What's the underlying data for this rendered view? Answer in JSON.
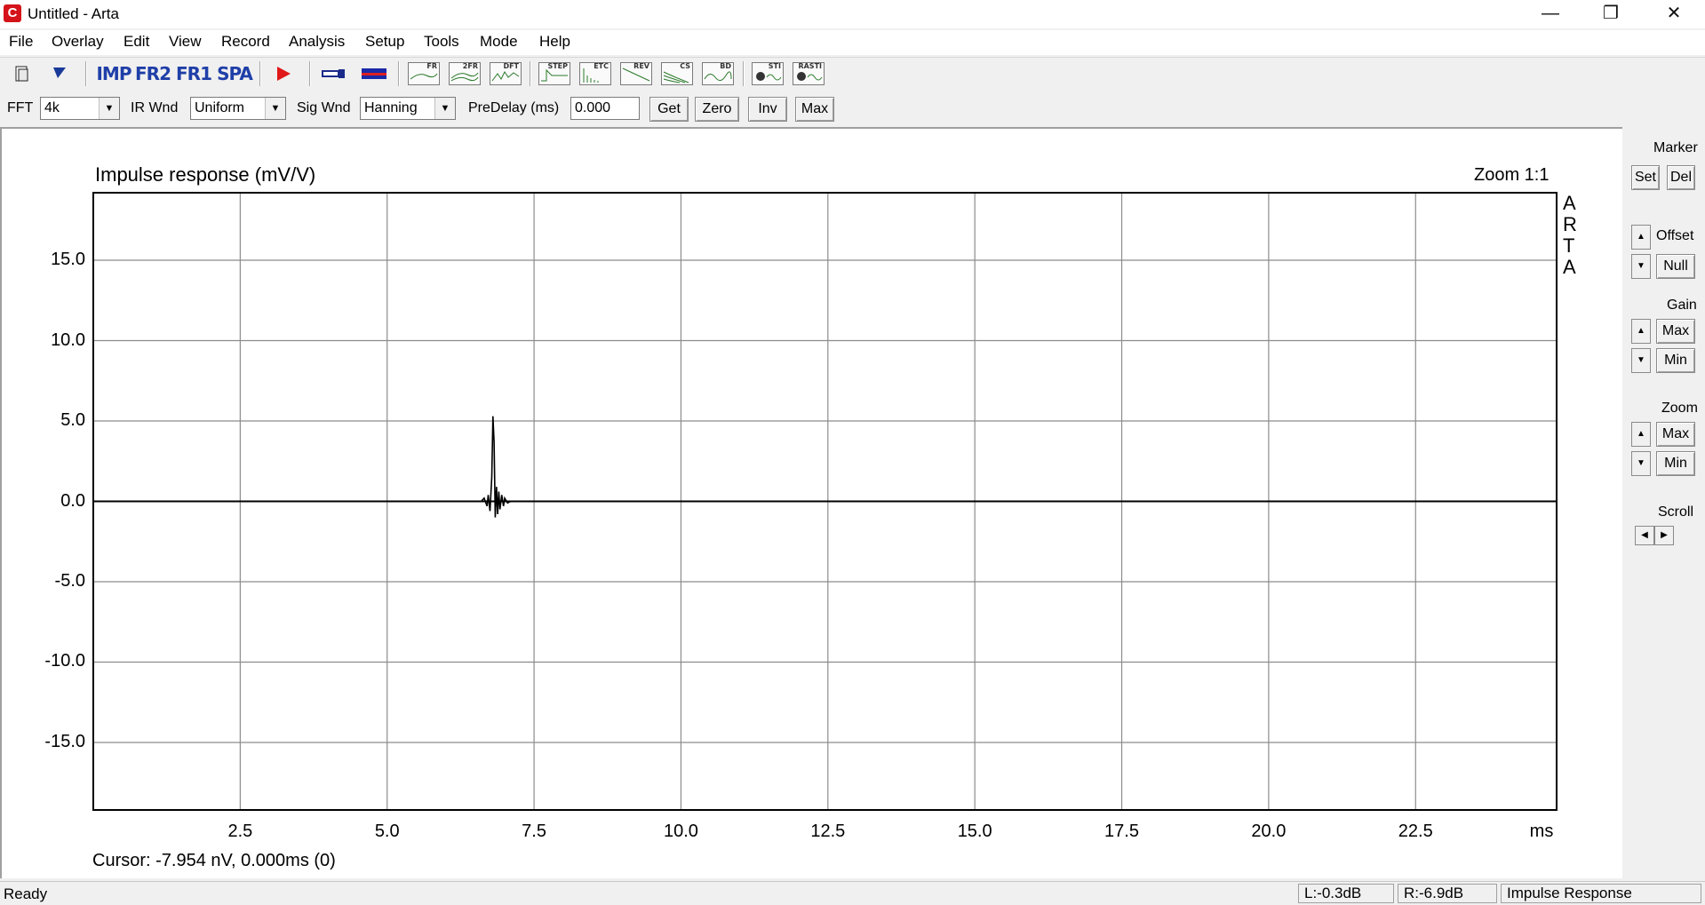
{
  "window": {
    "title": "Untitled - Arta",
    "app_icon_glyph": "C",
    "minimize_glyph": "—",
    "restore_glyph": "❐",
    "close_glyph": "✕"
  },
  "menu": [
    "File",
    "Overlay",
    "Edit",
    "View",
    "Record",
    "Analysis",
    "Setup",
    "Tools",
    "Mode",
    "Help"
  ],
  "toolbar": {
    "imp": "IMP",
    "fr2": "FR2",
    "fr1": "FR1",
    "spa": "SPA",
    "graph_buttons": [
      "FR",
      "2FR",
      "DFT",
      "STEP",
      "ETC",
      "REV",
      "CS",
      "BD",
      "STI",
      "RASTI"
    ]
  },
  "options": {
    "fft_label": "FFT",
    "fft_value": "4k",
    "ir_wnd_label": "IR Wnd",
    "ir_wnd_value": "Uniform",
    "sig_wnd_label": "Sig Wnd",
    "sig_wnd_value": "Hanning",
    "predelay_label": "PreDelay (ms)",
    "predelay_value": "0.000",
    "get": "Get",
    "zero": "Zero",
    "inv": "Inv",
    "max": "Max"
  },
  "plot": {
    "title": "Impulse response (mV/V)",
    "zoom": "Zoom 1:1",
    "watermark": [
      "A",
      "R",
      "T",
      "A"
    ],
    "x_unit": "ms",
    "cursor": "Cursor: -7.954 nV, 0.000ms (0)"
  },
  "chart_data": {
    "type": "line",
    "title": "Impulse response (mV/V)",
    "xlabel": "ms",
    "ylabel": "",
    "xlim": [
      0,
      24.9
    ],
    "ylim": [
      -19.2,
      19.2
    ],
    "xticks": [
      "2.5",
      "5.0",
      "7.5",
      "10.0",
      "12.5",
      "15.0",
      "17.5",
      "20.0",
      "22.5"
    ],
    "yticks": [
      "15.0",
      "10.0",
      "5.0",
      "0.0",
      "-5.0",
      "-10.0",
      "-15.0"
    ],
    "grid": true,
    "series": [
      {
        "x": [
          0,
          6.6,
          6.65,
          6.7,
          6.72,
          6.75,
          6.78,
          6.8,
          6.82,
          6.84,
          6.86,
          6.88,
          6.9,
          6.92,
          6.95,
          6.98,
          7.0,
          7.05,
          7.1,
          24.9
        ],
        "y": [
          0,
          0,
          0.2,
          -0.3,
          0.4,
          -0.6,
          1.5,
          5.3,
          3.7,
          -1.0,
          0.9,
          -0.8,
          0.6,
          -0.5,
          0.4,
          -0.3,
          0.2,
          -0.1,
          0,
          0
        ]
      }
    ]
  },
  "right_panel": {
    "marker": "Marker",
    "set": "Set",
    "del": "Del",
    "offset": "Offset",
    "null": "Null",
    "gain": "Gain",
    "gain_max": "Max",
    "gain_min": "Min",
    "zoom": "Zoom",
    "zoom_max": "Max",
    "zoom_min": "Min",
    "scroll": "Scroll"
  },
  "status": {
    "ready": "Ready",
    "left": "L:-0.3dB",
    "right": "R:-6.9dB",
    "mode": "Impulse Response"
  }
}
